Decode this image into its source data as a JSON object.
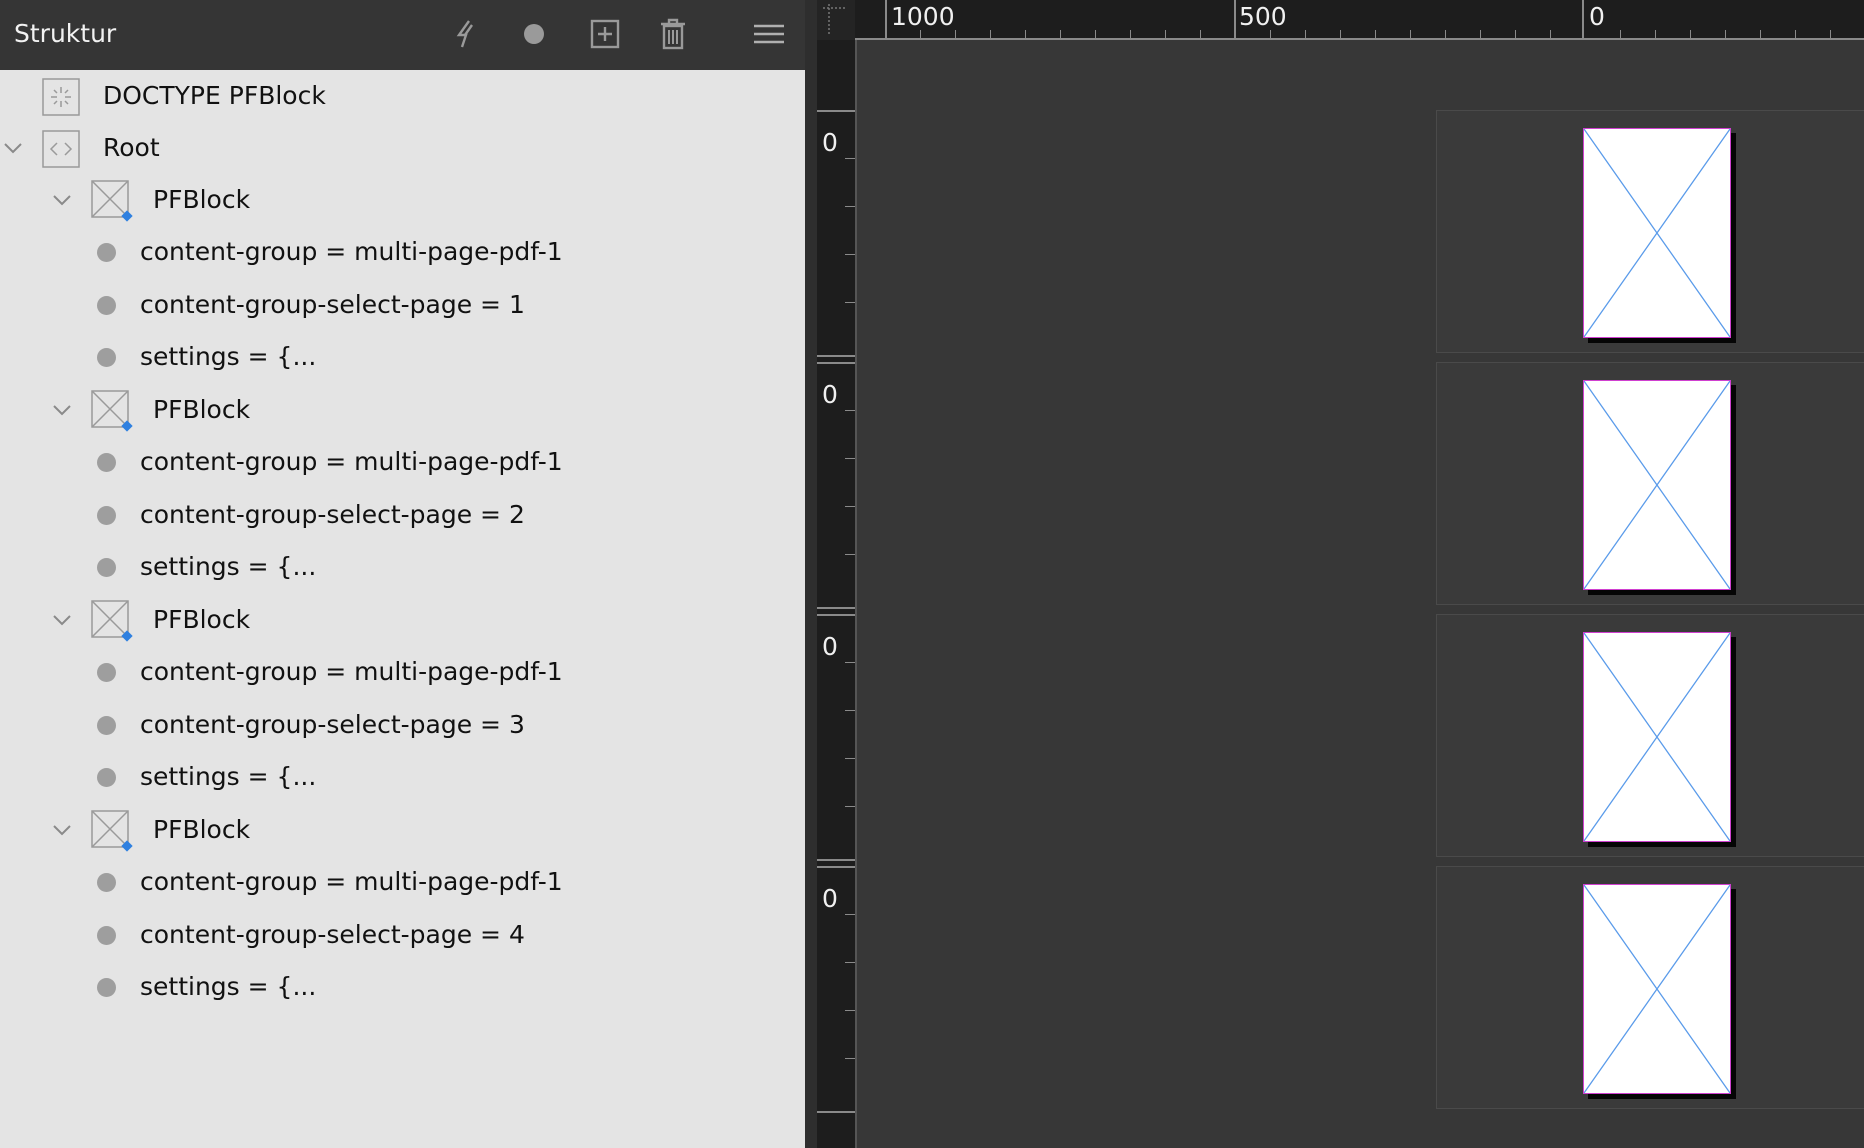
{
  "panel": {
    "title": "Struktur",
    "toolbar_icons": [
      "lightning-icon",
      "circle-icon",
      "add-square-icon",
      "trash-icon",
      "menu-icon"
    ],
    "accent_color": "#2f80e0",
    "tree": {
      "doctype": "DOCTYPE PFBlock",
      "root": "Root",
      "blocks": [
        {
          "label": "PFBlock",
          "attributes": [
            "content-group = multi-page-pdf-1",
            "content-group-select-page = 1",
            "settings = {..."
          ]
        },
        {
          "label": "PFBlock",
          "attributes": [
            "content-group = multi-page-pdf-1",
            "content-group-select-page = 2",
            "settings = {..."
          ]
        },
        {
          "label": "PFBlock",
          "attributes": [
            "content-group = multi-page-pdf-1",
            "content-group-select-page = 3",
            "settings = {..."
          ]
        },
        {
          "label": "PFBlock",
          "attributes": [
            "content-group = multi-page-pdf-1",
            "content-group-select-page = 4",
            "settings = {..."
          ]
        }
      ]
    }
  },
  "canvas": {
    "h_ruler_labels": [
      "1000",
      "500",
      "0"
    ],
    "v_ruler_labels": [
      "0",
      "0",
      "0",
      "0"
    ],
    "placeholder_line_color": "#5a9bea",
    "page_border_color": "#d040d0"
  }
}
